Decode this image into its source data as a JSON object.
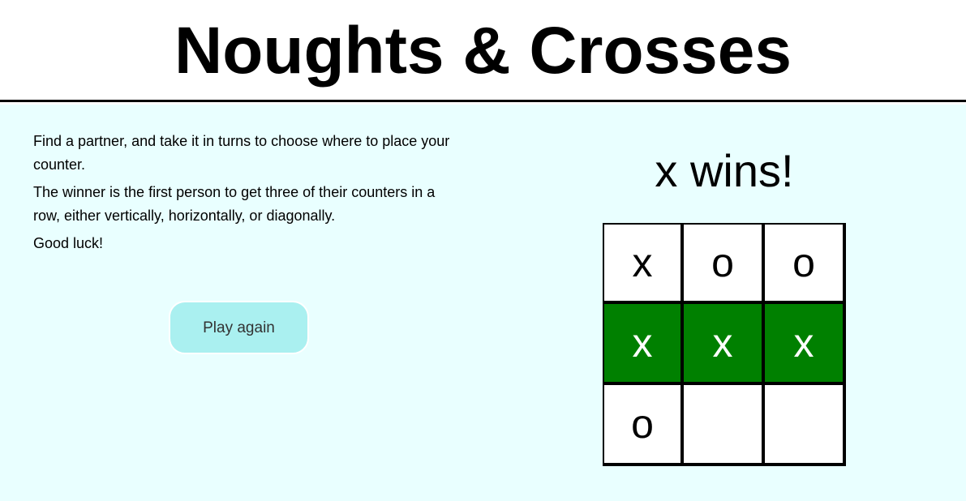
{
  "header": {
    "title": "Noughts & Crosses"
  },
  "instructions": {
    "paragraphs": [
      "Find a partner, and take it in turns to choose where to place your counter.",
      "The winner is the first person to get three of their counters in a row, either vertically, horizontally, or diagonally.",
      "Good luck!"
    ]
  },
  "controls": {
    "play_again_label": "Play again"
  },
  "game": {
    "status": "x wins!",
    "board": [
      [
        "x",
        "o",
        "o"
      ],
      [
        "x",
        "x",
        "x"
      ],
      [
        "o",
        "",
        ""
      ]
    ],
    "winning_row": 1,
    "colors": {
      "win_fill": "#008000",
      "background": "#e9ffff",
      "button": "#aaf0f0"
    }
  }
}
